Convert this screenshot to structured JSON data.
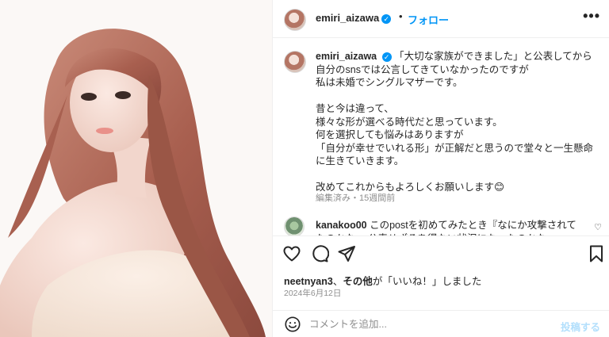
{
  "post": {
    "username": "emiri_aizawa",
    "separator": "•",
    "follow_label": "フォロー",
    "more_icon": "more-horizontal-icon"
  },
  "caption": {
    "username": "emiri_aizawa",
    "lines": [
      "「大切な家族ができました」と公表してから",
      "自分のsnsでは公言してきていなかったのですが",
      "私は未婚でシングルマザーです。",
      "",
      "昔と今は違って、",
      "様々な形が選べる時代だと思っています。",
      "何を選択しても悩みはありますが",
      "「自分が幸せでいれる形」が正解だと思うので堂々と一生懸命",
      "に生きていきます。",
      "",
      "改めてこれからもよろしくお願いします"
    ],
    "emoji": "😊",
    "meta": "編集済み・15週間前"
  },
  "comment": {
    "username": "kanakoo00",
    "text": "このpostを初めてみたとき『なにか攻撃されてたのかな… 公表せざるを得ない状況になったのかな…』"
  },
  "actions": {
    "like_icon": "heart-icon",
    "comment_icon": "comment-icon",
    "share_icon": "share-icon",
    "save_icon": "bookmark-icon"
  },
  "likes": {
    "user": "neetnyan3",
    "sep": "、",
    "others": "その他",
    "suffix": "が「いいね！」しました"
  },
  "date": "2024年6月12日",
  "add_comment": {
    "placeholder": "コメントを追加...",
    "post_label": "投稿する"
  },
  "colors": {
    "accent": "#0095f6",
    "muted": "#8e8e8e",
    "post_disabled": "#b2dffc"
  }
}
